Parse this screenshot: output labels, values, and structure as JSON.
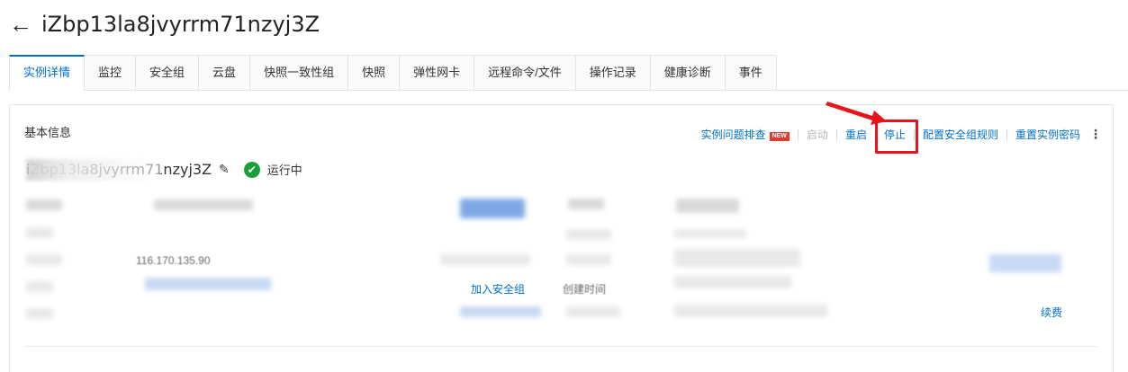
{
  "header": {
    "title": "iZbp13la8jvyrrm71nzyj3Z"
  },
  "tabs": [
    {
      "label": "实例详情",
      "active": true
    },
    {
      "label": "监控"
    },
    {
      "label": "安全组"
    },
    {
      "label": "云盘"
    },
    {
      "label": "快照一致性组"
    },
    {
      "label": "快照"
    },
    {
      "label": "弹性网卡"
    },
    {
      "label": "远程命令/文件"
    },
    {
      "label": "操作记录"
    },
    {
      "label": "健康诊断"
    },
    {
      "label": "事件"
    }
  ],
  "panel": {
    "section_title": "基本信息",
    "actions": {
      "troubleshoot": "实例问题排查",
      "new_badge": "NEW",
      "start": "启动",
      "restart": "重启",
      "stop": "停止",
      "security_rules": "配置安全组规则",
      "reset_password": "重置实例密码"
    },
    "instance_name": "iZbp13la8jvyrrm71nzyj3Z",
    "status": "运行中",
    "fields": {
      "ip_partial": "116.170.135.90",
      "join_security_group": "加入安全组",
      "created_time_label": "创建时间",
      "renew": "续费"
    }
  },
  "colors": {
    "accent": "#0070cc",
    "status_green": "#1a9f3a",
    "highlight_red": "#e8141b"
  }
}
